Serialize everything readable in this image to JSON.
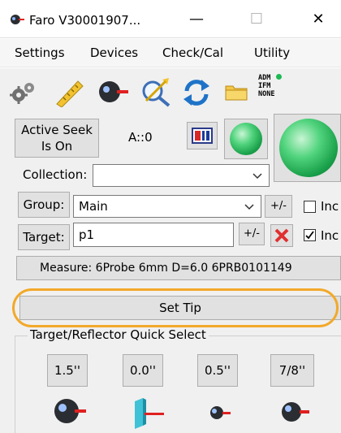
{
  "window": {
    "title": "Faro V30001907..."
  },
  "window_controls": {
    "minimize": "—",
    "maximize": "☐",
    "close": "✕"
  },
  "menu": [
    "Settings",
    "Devices",
    "Check/Cal",
    "Utility"
  ],
  "toolbar": {
    "adm_lines": [
      "ADM",
      "IFM",
      "NONE"
    ],
    "adm_status_color": "#1db954"
  },
  "seek": {
    "label_line1": "Active Seek",
    "label_line2": "Is On",
    "angle": "A::0"
  },
  "collection": {
    "label": "Collection:",
    "value": ""
  },
  "group": {
    "label": "Group:",
    "value": "Main",
    "plusminus": "+/-",
    "inc_label": "Inc"
  },
  "target": {
    "label": "Target:",
    "value": "p1",
    "plusminus": "+/-",
    "inc_label": "Inc",
    "inc_checked": true
  },
  "measure": {
    "text": "Measure: 6Probe 6mm D=6.0 6PRB0101149"
  },
  "set_tip": {
    "label": "Set Tip"
  },
  "quick_select": {
    "title": "Target/Reflector Quick Select",
    "sizes": [
      "1.5''",
      "0.0''",
      "0.5''",
      "7/8''"
    ]
  },
  "colors": {
    "accent_highlight": "#f2a92a",
    "sphere_green": "#1aa04a",
    "delete_red": "#e03030"
  }
}
